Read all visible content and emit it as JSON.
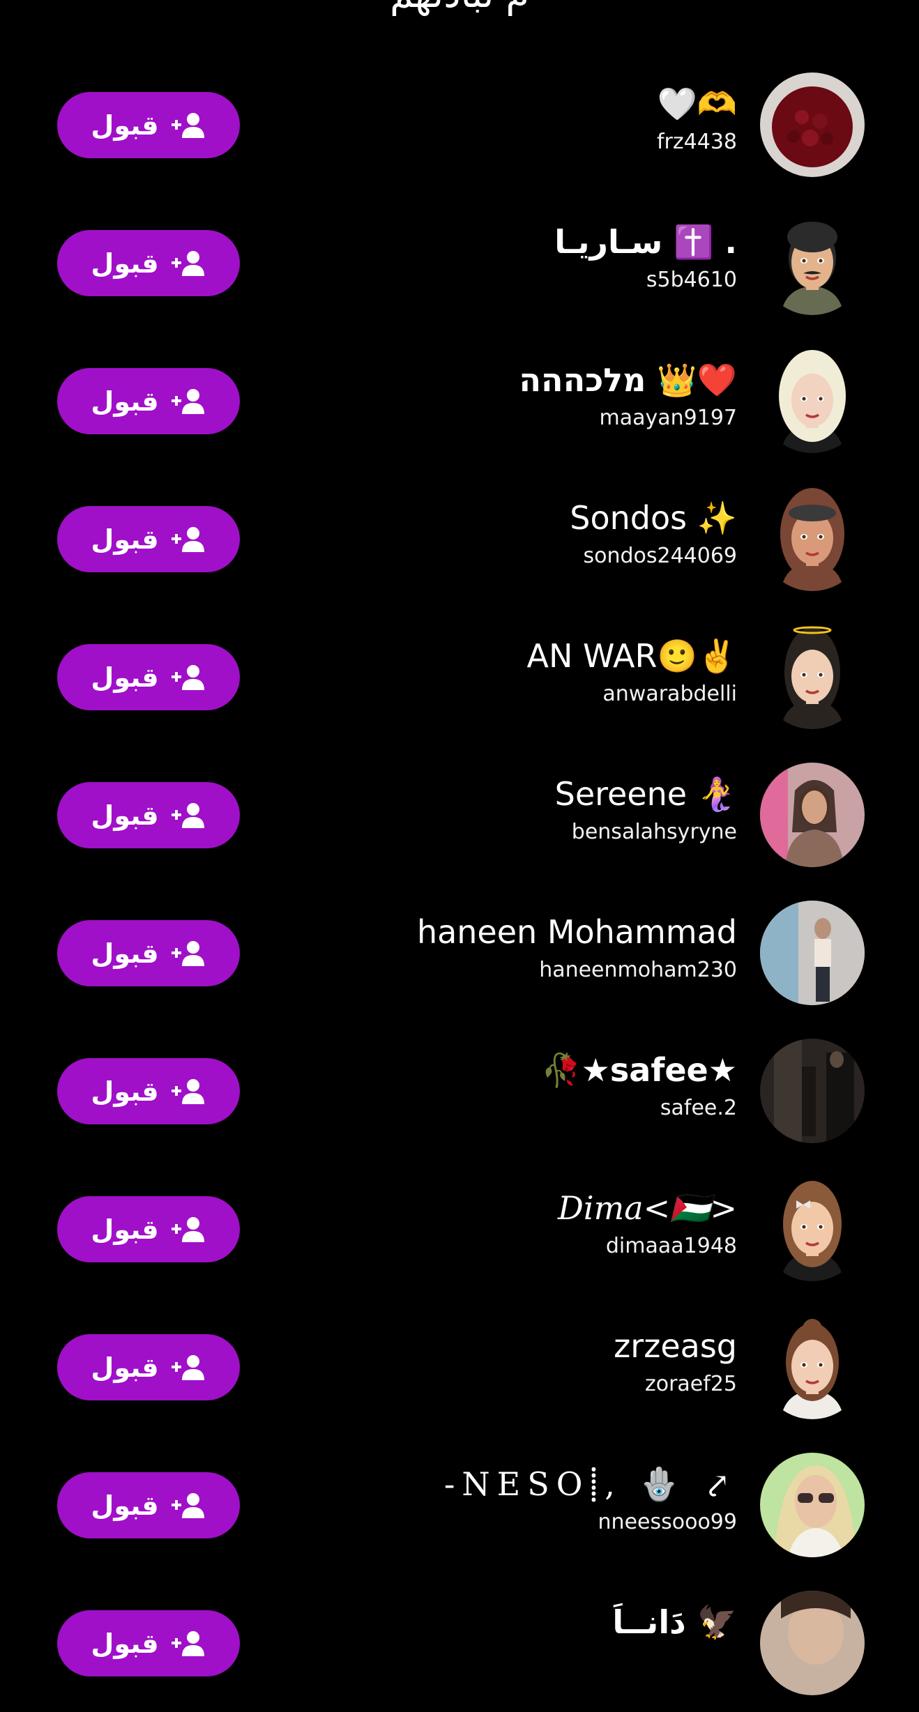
{
  "header": {
    "title": "م تبادلهم"
  },
  "accept_label": "قبول",
  "accent_color": "#a010c8",
  "requests": [
    {
      "display_name": "🤍🫶",
      "username": "frz4438",
      "avatar": "photo-roses",
      "style": ""
    },
    {
      "display_name": "سـاريـا ✝️ .",
      "username": "s5b4610",
      "avatar": "bitmoji-man",
      "style": "bold"
    },
    {
      "display_name": "מלכההה 👑❤️",
      "username": "maayan9197",
      "avatar": "bitmoji-blonde",
      "style": "bold"
    },
    {
      "display_name": "Sondos ✨",
      "username": "sondos244069",
      "avatar": "bitmoji-crown",
      "style": ""
    },
    {
      "display_name": "AN WAR🙂✌️",
      "username": "anwarabdelli",
      "avatar": "bitmoji-halo",
      "style": ""
    },
    {
      "display_name": "Sereene 🧜‍♀️",
      "username": "bensalahsyryne",
      "avatar": "photo-woman",
      "style": ""
    },
    {
      "display_name": "haneen Mohammad",
      "username": "haneenmoham230",
      "avatar": "photo-mirror",
      "style": ""
    },
    {
      "display_name": "🥀★safee★",
      "username": "safee.2",
      "avatar": "photo-dark",
      "style": "bold"
    },
    {
      "display_name": "Dima<🇵🇸>",
      "username": "dimaaa1948",
      "avatar": "bitmoji-bow",
      "style": "serif-italic"
    },
    {
      "display_name": "zrzeasg",
      "username": "zoraef25",
      "avatar": "bitmoji-bun",
      "style": ""
    },
    {
      "display_name": "-NESO⸽, 🪬 ⤤",
      "username": "nneessooo99",
      "avatar": "photo-sunglasses",
      "style": "mono"
    },
    {
      "display_name": "دَانــاَ 🦅",
      "username": "",
      "avatar": "photo-partial",
      "style": "bold"
    }
  ]
}
